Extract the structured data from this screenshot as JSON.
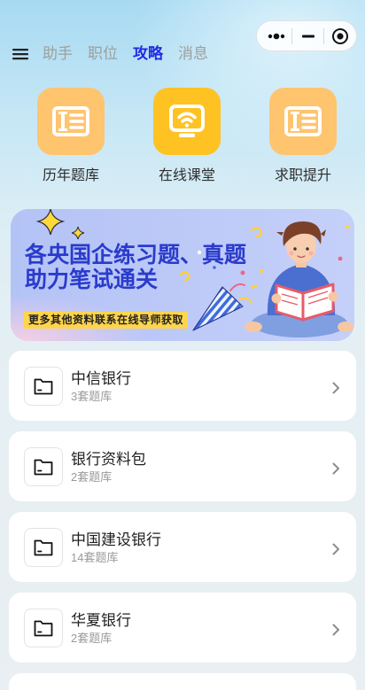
{
  "colors": {
    "accent": "#1f2be6",
    "tab_inactive": "#9e9e9e",
    "tile_orange": "#ffc46e",
    "tile_yellow": "#ffc223",
    "banner_text": "#2a3bcc",
    "note_bg": "#ffd54c"
  },
  "capsule": {
    "more_icon": "more-dots-icon",
    "minimize_icon": "minimize-icon",
    "close_icon": "target-icon"
  },
  "nav": {
    "menu_icon": "menu-icon",
    "tabs": [
      {
        "label": "助手",
        "active": false
      },
      {
        "label": "职位",
        "active": false
      },
      {
        "label": "攻略",
        "active": true
      },
      {
        "label": "消息",
        "active": false
      }
    ]
  },
  "shortcuts": [
    {
      "label": "历年题库",
      "icon": "ticket-icon"
    },
    {
      "label": "在线课堂",
      "icon": "online-class-icon"
    },
    {
      "label": "求职提升",
      "icon": "ticket-icon"
    }
  ],
  "banner": {
    "line1": "各央国企练习题、真题",
    "line2": "助力笔试通关",
    "note": "更多其他资料联系在线导师获取"
  },
  "list": [
    {
      "title": "中信银行",
      "subtitle": "3套题库",
      "icon": "folder-icon"
    },
    {
      "title": "银行资料包",
      "subtitle": "2套题库",
      "icon": "folder-icon"
    },
    {
      "title": "中国建设银行",
      "subtitle": "14套题库",
      "icon": "folder-icon"
    },
    {
      "title": "华夏银行",
      "subtitle": "2套题库",
      "icon": "folder-icon"
    }
  ]
}
